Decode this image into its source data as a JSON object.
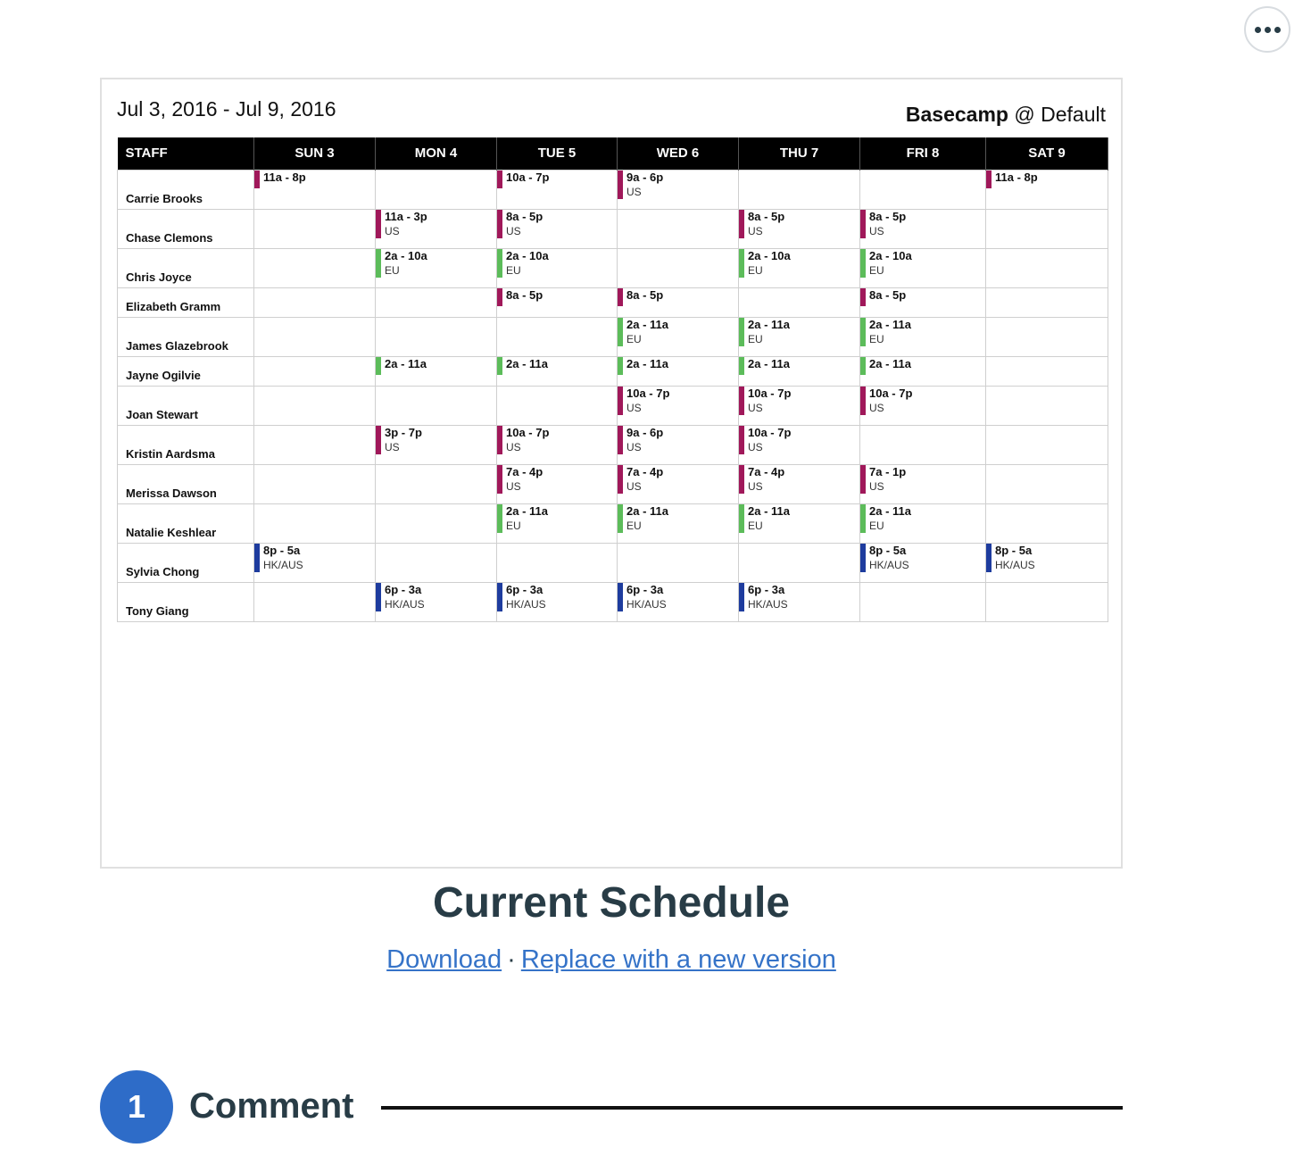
{
  "more_menu": {
    "icon": "ellipsis-icon"
  },
  "schedule": {
    "date_range": "Jul 3, 2016 - Jul 9, 2016",
    "brand": "Basecamp",
    "brand_suffix": "@ Default",
    "headers": [
      "STAFF",
      "SUN 3",
      "MON 4",
      "TUE 5",
      "WED 6",
      "THU 7",
      "FRI 8",
      "SAT 9"
    ],
    "colors": {
      "us": "#a0185a",
      "eu": "#5cbc5a",
      "hk": "#1e3c9e"
    },
    "rows": [
      {
        "name": "Carrie Brooks",
        "shifts": [
          {
            "time": "11a - 8p",
            "region": "",
            "color": "us"
          },
          null,
          {
            "time": "10a - 7p",
            "region": "",
            "color": "us"
          },
          {
            "time": "9a - 6p",
            "region": "US",
            "color": "us"
          },
          null,
          null,
          {
            "time": "11a - 8p",
            "region": "",
            "color": "us"
          }
        ]
      },
      {
        "name": "Chase Clemons",
        "shifts": [
          null,
          {
            "time": "11a - 3p",
            "region": "US",
            "color": "us"
          },
          {
            "time": "8a - 5p",
            "region": "US",
            "color": "us"
          },
          null,
          {
            "time": "8a - 5p",
            "region": "US",
            "color": "us"
          },
          {
            "time": "8a - 5p",
            "region": "US",
            "color": "us"
          },
          null
        ]
      },
      {
        "name": "Chris Joyce",
        "shifts": [
          null,
          {
            "time": "2a - 10a",
            "region": "EU",
            "color": "eu"
          },
          {
            "time": "2a - 10a",
            "region": "EU",
            "color": "eu"
          },
          null,
          {
            "time": "2a - 10a",
            "region": "EU",
            "color": "eu"
          },
          {
            "time": "2a - 10a",
            "region": "EU",
            "color": "eu"
          },
          null
        ]
      },
      {
        "name": "Elizabeth Gramm",
        "shifts": [
          null,
          null,
          {
            "time": "8a - 5p",
            "region": "",
            "color": "us"
          },
          {
            "time": "8a - 5p",
            "region": "",
            "color": "us"
          },
          null,
          {
            "time": "8a - 5p",
            "region": "",
            "color": "us"
          },
          null
        ]
      },
      {
        "name": "James Glazebrook",
        "shifts": [
          null,
          null,
          null,
          {
            "time": "2a - 11a",
            "region": "EU",
            "color": "eu"
          },
          {
            "time": "2a - 11a",
            "region": "EU",
            "color": "eu"
          },
          {
            "time": "2a - 11a",
            "region": "EU",
            "color": "eu"
          },
          null
        ]
      },
      {
        "name": "Jayne Ogilvie",
        "shifts": [
          null,
          {
            "time": "2a - 11a",
            "region": "",
            "color": "eu"
          },
          {
            "time": "2a - 11a",
            "region": "",
            "color": "eu"
          },
          {
            "time": "2a - 11a",
            "region": "",
            "color": "eu"
          },
          {
            "time": "2a - 11a",
            "region": "",
            "color": "eu"
          },
          {
            "time": "2a - 11a",
            "region": "",
            "color": "eu"
          },
          null
        ]
      },
      {
        "name": "Joan Stewart",
        "shifts": [
          null,
          null,
          null,
          {
            "time": "10a - 7p",
            "region": "US",
            "color": "us"
          },
          {
            "time": "10a - 7p",
            "region": "US",
            "color": "us"
          },
          {
            "time": "10a - 7p",
            "region": "US",
            "color": "us"
          },
          null
        ]
      },
      {
        "name": "Kristin Aardsma",
        "shifts": [
          null,
          {
            "time": "3p - 7p",
            "region": "US",
            "color": "us"
          },
          {
            "time": "10a - 7p",
            "region": "US",
            "color": "us"
          },
          {
            "time": "9a - 6p",
            "region": "US",
            "color": "us"
          },
          {
            "time": "10a - 7p",
            "region": "US",
            "color": "us"
          },
          null,
          null
        ]
      },
      {
        "name": "Merissa Dawson",
        "shifts": [
          null,
          null,
          {
            "time": "7a - 4p",
            "region": "US",
            "color": "us"
          },
          {
            "time": "7a - 4p",
            "region": "US",
            "color": "us"
          },
          {
            "time": "7a - 4p",
            "region": "US",
            "color": "us"
          },
          {
            "time": "7a - 1p",
            "region": "US",
            "color": "us"
          },
          null
        ]
      },
      {
        "name": "Natalie Keshlear",
        "shifts": [
          null,
          null,
          {
            "time": "2a - 11a",
            "region": "EU",
            "color": "eu"
          },
          {
            "time": "2a - 11a",
            "region": "EU",
            "color": "eu"
          },
          {
            "time": "2a - 11a",
            "region": "EU",
            "color": "eu"
          },
          {
            "time": "2a - 11a",
            "region": "EU",
            "color": "eu"
          },
          null
        ]
      },
      {
        "name": "Sylvia Chong",
        "shifts": [
          {
            "time": "8p - 5a",
            "region": "HK/AUS",
            "color": "hk"
          },
          null,
          null,
          null,
          null,
          {
            "time": "8p - 5a",
            "region": "HK/AUS",
            "color": "hk"
          },
          {
            "time": "8p - 5a",
            "region": "HK/AUS",
            "color": "hk"
          }
        ]
      },
      {
        "name": "Tony Giang",
        "shifts": [
          null,
          {
            "time": "6p - 3a",
            "region": "HK/AUS",
            "color": "hk"
          },
          {
            "time": "6p - 3a",
            "region": "HK/AUS",
            "color": "hk"
          },
          {
            "time": "6p - 3a",
            "region": "HK/AUS",
            "color": "hk"
          },
          {
            "time": "6p - 3a",
            "region": "HK/AUS",
            "color": "hk"
          },
          null,
          null
        ]
      }
    ]
  },
  "document": {
    "title": "Current Schedule",
    "download_label": "Download",
    "separator": "·",
    "replace_label": "Replace with a new version"
  },
  "comments": {
    "count": "1",
    "label": "Comment"
  }
}
